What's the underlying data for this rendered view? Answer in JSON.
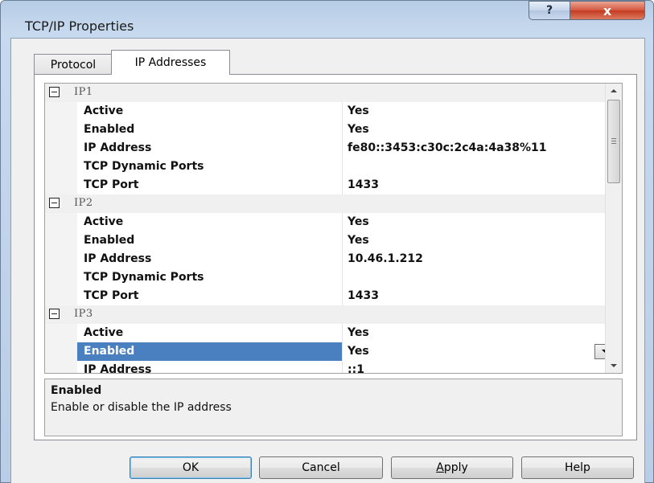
{
  "window": {
    "title": "TCP/IP Properties",
    "help_glyph": "?",
    "close_glyph": "x"
  },
  "tabs": [
    {
      "label": "Protocol",
      "selected": false
    },
    {
      "label": "IP Addresses",
      "selected": true
    }
  ],
  "grid": {
    "groups": [
      {
        "name": "IP1",
        "properties": [
          {
            "name": "Active",
            "value": "Yes"
          },
          {
            "name": "Enabled",
            "value": "Yes"
          },
          {
            "name": "IP Address",
            "value": "fe80::3453:c30c:2c4a:4a38%11"
          },
          {
            "name": "TCP Dynamic Ports",
            "value": ""
          },
          {
            "name": "TCP Port",
            "value": "1433"
          }
        ]
      },
      {
        "name": "IP2",
        "properties": [
          {
            "name": "Active",
            "value": "Yes"
          },
          {
            "name": "Enabled",
            "value": "Yes"
          },
          {
            "name": "IP Address",
            "value": "10.46.1.212"
          },
          {
            "name": "TCP Dynamic Ports",
            "value": ""
          },
          {
            "name": "TCP Port",
            "value": "1433"
          }
        ]
      },
      {
        "name": "IP3",
        "properties": [
          {
            "name": "Active",
            "value": "Yes"
          },
          {
            "name": "Enabled",
            "value": "Yes",
            "selected": true
          },
          {
            "name": "IP Address",
            "value": "::1"
          }
        ]
      }
    ],
    "selection_color": "#4a7fc0"
  },
  "description": {
    "title": "Enabled",
    "text": "Enable or disable the IP address"
  },
  "buttons": {
    "ok": "OK",
    "cancel": "Cancel",
    "apply_accel": "A",
    "apply_rest": "pply",
    "help": "Help"
  }
}
